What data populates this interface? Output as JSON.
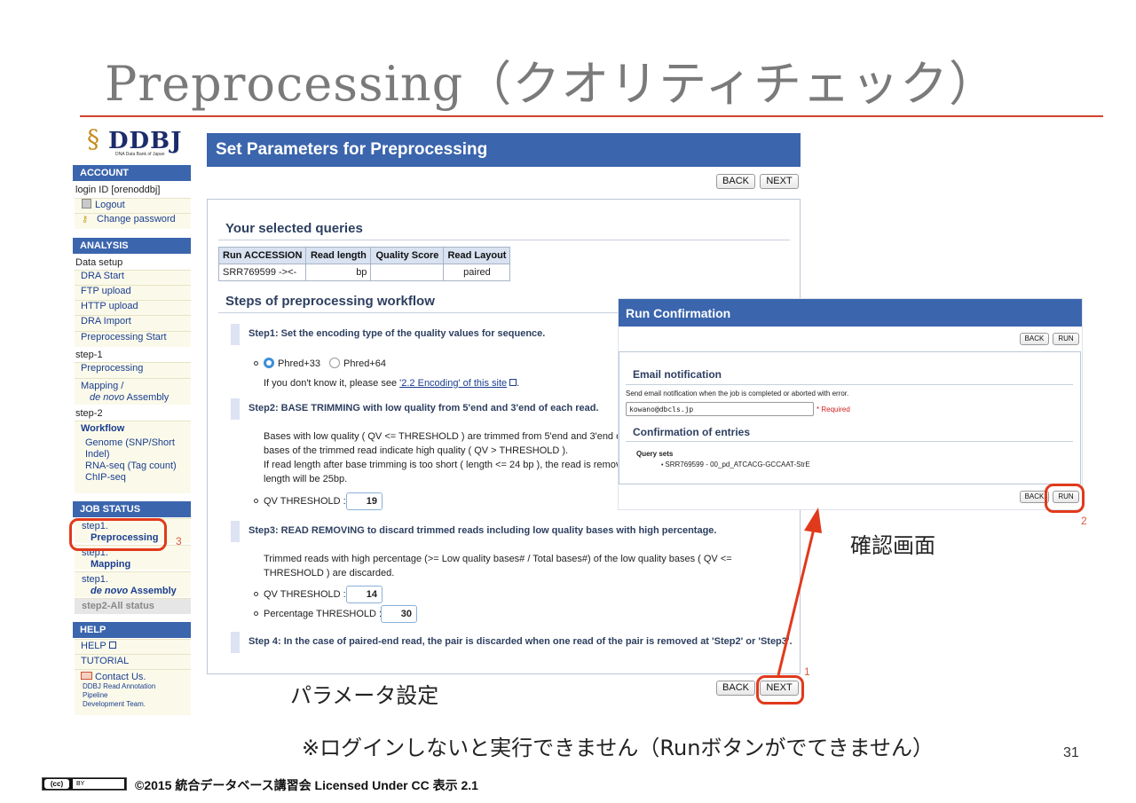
{
  "slide": {
    "title": "Preprocessing（クオリティチェック）",
    "page_number": "31",
    "label_params": "パラメータ設定",
    "label_confirm": "確認画面",
    "note": "※ログインしないと実行できません（Runボタンがでてきません）",
    "footer": "©2015 統合データベース講習会 Licensed Under CC 表示 2.1",
    "cc_badge": {
      "cc": "(cc)",
      "by": "BY"
    },
    "annotation_numbers": [
      "1",
      "2",
      "3"
    ]
  },
  "sidebar": {
    "logo": "DDBJ",
    "logo_sub": "DNA Data Bank of Japan",
    "account_head": "ACCOUNT",
    "login_id": "login ID [orenoddbj]",
    "logout": "Logout",
    "change_password": "Change password",
    "analysis_head": "ANALYSIS",
    "data_setup": "Data setup",
    "data_items": [
      "DRA Start",
      "FTP upload",
      "HTTP upload",
      "DRA Import",
      "Preprocessing Start"
    ],
    "step1_label": "step-1",
    "step1_items": [
      "Preprocessing",
      "Mapping /",
      "de novo",
      "Assembly"
    ],
    "step2_label": "step-2",
    "workflow": "Workflow",
    "workflow_items": [
      "Genome (SNP/Short",
      "Indel)",
      "RNA-seq (Tag count)",
      "ChIP-seq"
    ],
    "job_status_head": "JOB STATUS",
    "jobs": [
      {
        "step": "step1.",
        "name": "Preprocessing"
      },
      {
        "step": "step1.",
        "name": "Mapping"
      },
      {
        "step": "step1.",
        "name_italic": "de novo",
        "name": "Assembly"
      }
    ],
    "all_status": "step2-All status",
    "help_head": "HELP",
    "help": "HELP",
    "tutorial": "TUTORIAL",
    "contact": "Contact Us.",
    "contact_sub": [
      "DDBJ Read Annotation",
      "Pipeline",
      "Development Team."
    ]
  },
  "main": {
    "header": "Set Parameters for Preprocessing",
    "back": "BACK",
    "next": "NEXT",
    "selected_queries": "Your selected queries",
    "table": {
      "headers": [
        "Run ACCESSION",
        "Read length",
        "Quality Score",
        "Read Layout"
      ],
      "row": [
        "SRR769599 -><-",
        "bp",
        "",
        "paired"
      ]
    },
    "steps_heading": "Steps of preprocessing workflow",
    "step1": "Step1: Set the encoding type of the quality values for sequence.",
    "phred33": "Phred+33",
    "phred64": "Phred+64",
    "encoding_hint": "If you don't know it, please see",
    "encoding_link": "'2.2 Encoding' of this site",
    "encoding_tail": ".",
    "step2": "Step2: BASE TRIMMING with low quality from 5'end and 3'end of each read.",
    "step2_desc": [
      "Bases with low quality ( QV <= THRESHOLD ) are trimmed from 5'end and 3'end of",
      "bases of the trimmed read indicate high quality ( QV > THRESHOLD ).",
      "If read length after base trimming is too short ( length <= 24 bp ), the read is remove",
      "length will be 25bp."
    ],
    "qv_threshold_label": "QV THRESHOLD :",
    "qv_threshold_step2": "19",
    "step3": "Step3: READ REMOVING to discard trimmed reads including low quality bases with high percentage.",
    "step3_desc": [
      "Trimmed reads with high percentage (>= Low quality bases# / Total bases#) of the low quality bases ( QV <=",
      "THRESHOLD ) are discarded."
    ],
    "qv_threshold_step3": "14",
    "percentage_label": "Percentage THRESHOLD :",
    "percentage_value": "30",
    "step4": "Step 4: In the case of paired-end read, the pair is discarded when one read of the pair is removed at 'Step2' or 'Step3'."
  },
  "run_confirmation": {
    "header": "Run Confirmation",
    "back": "BACK",
    "run": "RUN",
    "email_heading": "Email notification",
    "email_desc": "Send email notification when the job is completed or aborted with error.",
    "email_value": "kowano@dbcls.jp",
    "required": "* Required",
    "confirm_heading": "Confirmation of entries",
    "query_sets": "Query sets",
    "query_item": "SRR769599 - 00_pd_ATCACG-GCCAAT-StrE"
  },
  "colors": {
    "accent_blue": "#3b65ad",
    "annotation_red": "#e03a1c",
    "title_rule": "#d0442c"
  }
}
